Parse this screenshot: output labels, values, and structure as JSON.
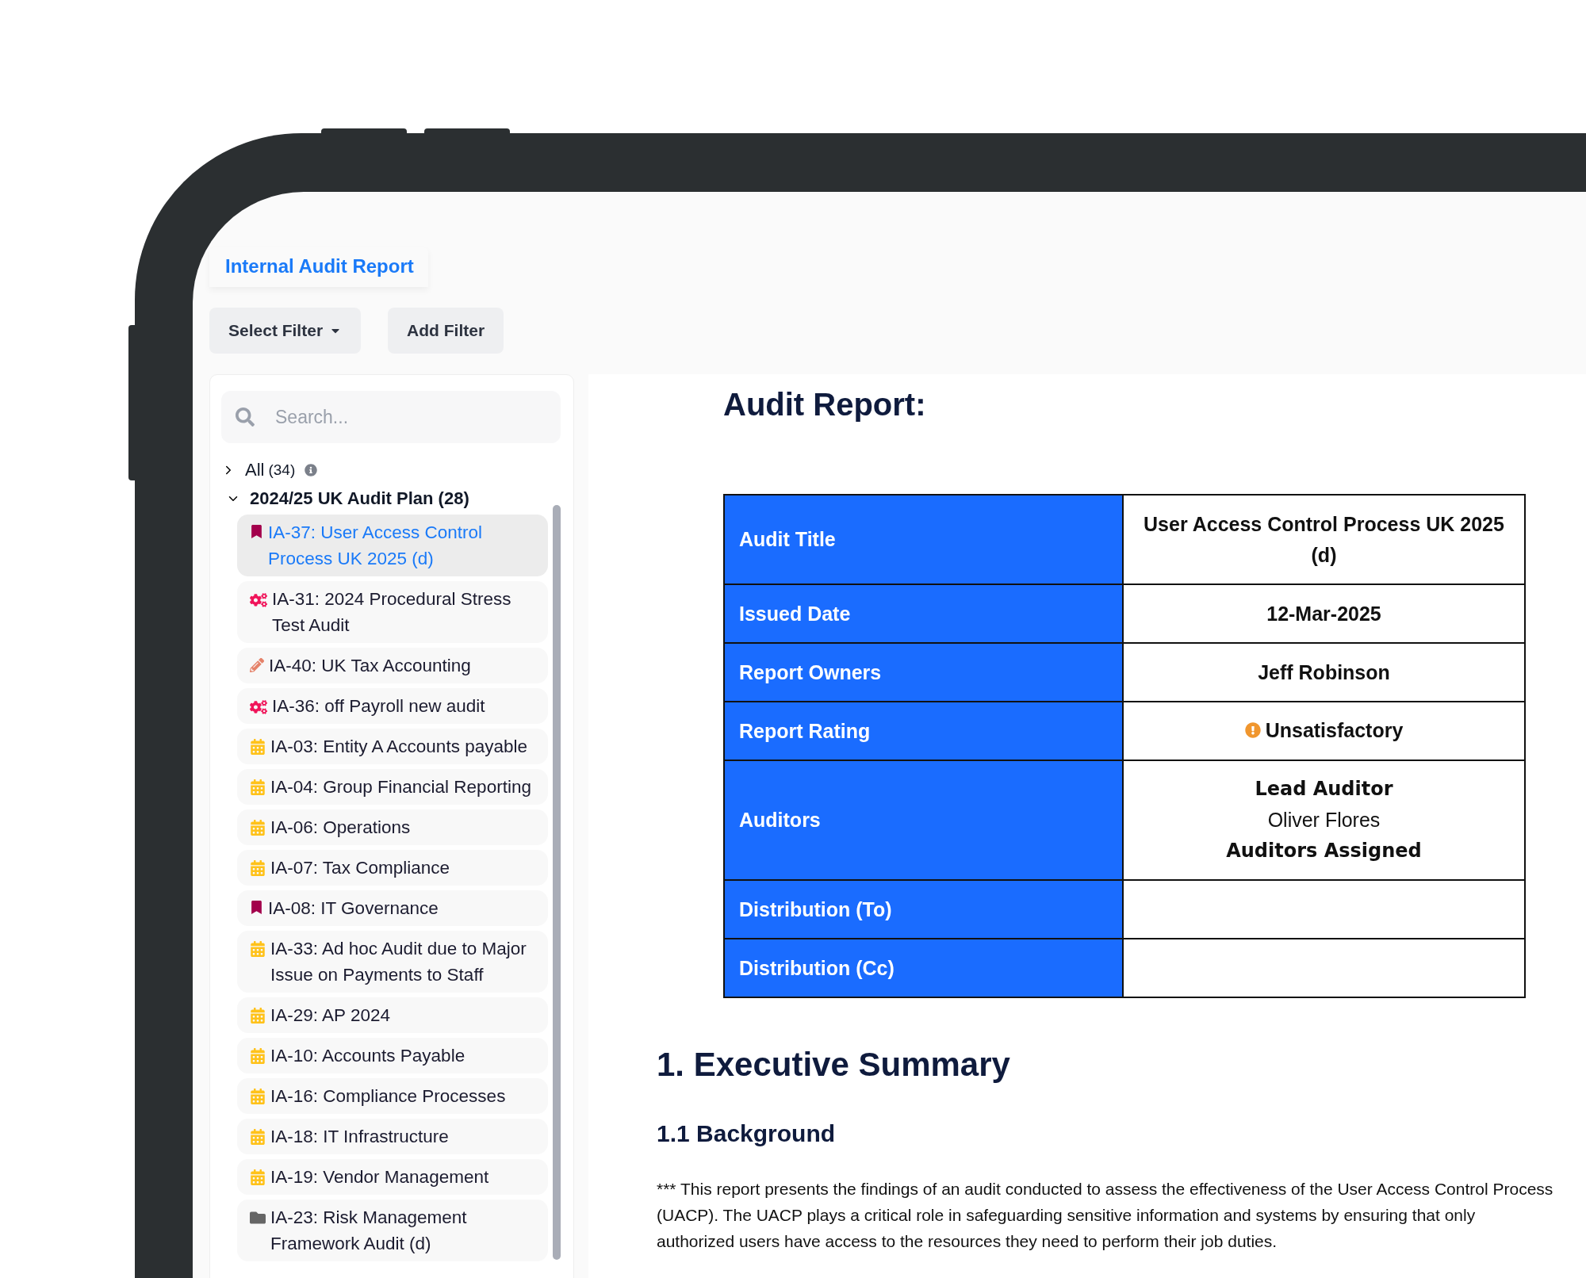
{
  "tab": {
    "label": "Internal Audit Report",
    "selected": true
  },
  "filters": {
    "select_label": "Select Filter",
    "add_label": "Add Filter"
  },
  "search": {
    "placeholder": "Search..."
  },
  "tree": [
    {
      "label": "All",
      "count": "(34)",
      "expanded": false
    },
    {
      "label": "2024/25 UK Audit Plan (28)",
      "expanded": true,
      "children": [
        {
          "kind": "bookmark",
          "label": "IA-37: User Access Control Process UK 2025 (d)",
          "selected": true
        },
        {
          "kind": "gears",
          "label": "IA-31: 2024 Procedural Stress Test Audit",
          "selected": false
        },
        {
          "kind": "pencil",
          "label": "IA-40: UK Tax Accounting",
          "selected": false
        },
        {
          "kind": "gears",
          "label": "IA-36: off Payroll new audit",
          "selected": false
        },
        {
          "kind": "calendar",
          "label": "IA-03: Entity A Accounts payable",
          "selected": false
        },
        {
          "kind": "calendar",
          "label": "IA-04: Group Financial Reporting",
          "selected": false
        },
        {
          "kind": "calendar",
          "label": "IA-06: Operations",
          "selected": false
        },
        {
          "kind": "calendar",
          "label": "IA-07: Tax Compliance",
          "selected": false
        },
        {
          "kind": "bookmark",
          "label": "IA-08: IT Governance",
          "selected": false
        },
        {
          "kind": "calendar",
          "label": "IA-33: Ad hoc Audit due to Major Issue on Payments to Staff",
          "selected": false
        },
        {
          "kind": "calendar",
          "label": "IA-29: AP 2024",
          "selected": false
        },
        {
          "kind": "calendar",
          "label": "IA-10: Accounts Payable",
          "selected": false
        },
        {
          "kind": "calendar",
          "label": "IA-16: Compliance Processes",
          "selected": false
        },
        {
          "kind": "calendar",
          "label": "IA-18: IT Infrastructure",
          "selected": false
        },
        {
          "kind": "calendar",
          "label": "IA-19: Vendor Management",
          "selected": false
        },
        {
          "kind": "folder",
          "label": "IA-23: Risk Management Framework Audit (d)",
          "selected": false
        }
      ]
    }
  ],
  "report": {
    "title": "Audit Report:",
    "rows": [
      {
        "kind": "text",
        "label": "Audit Title",
        "value": "User Access Control Process UK 2025 (d)"
      },
      {
        "kind": "text",
        "label": "Issued Date",
        "value": "12-Mar-2025"
      },
      {
        "kind": "text",
        "label": "Report Owners",
        "value": "Jeff Robinson"
      },
      {
        "kind": "rating",
        "label": "Report Rating",
        "value": "Unsatisfactory"
      },
      {
        "kind": "list",
        "label": "Auditors",
        "lines": [
          {
            "kind": "heading",
            "text": "Lead Auditor"
          },
          {
            "kind": "name",
            "text": "Oliver Flores"
          },
          {
            "kind": "heading",
            "text": "Auditors Assigned"
          }
        ]
      },
      {
        "kind": "empty",
        "label": "Distribution (To)"
      },
      {
        "kind": "empty",
        "label": "Distribution (Cc)"
      }
    ],
    "section_heading": "1. Executive Summary",
    "subheading": "1.1 Background",
    "paragraph": "*** This report presents the findings of an audit conducted to assess the effectiveness of the User Access Control Process (UACP). The UACP plays a critical role in safeguarding sensitive information and systems by ensuring that only authorized users have access to the resources they need to perform their job duties."
  }
}
